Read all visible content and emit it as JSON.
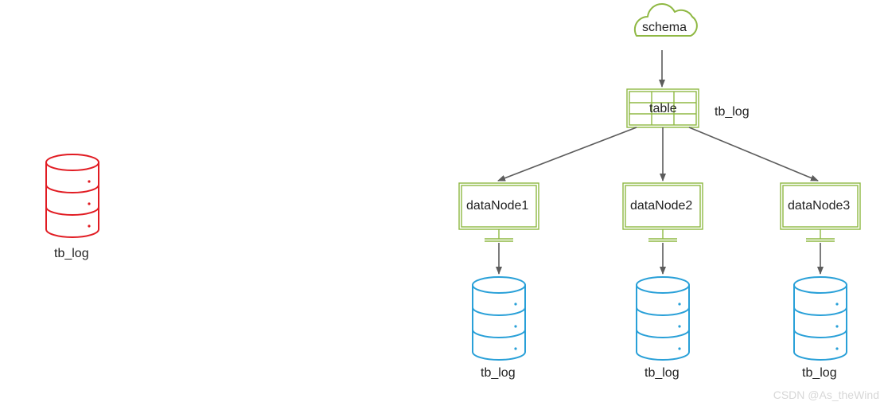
{
  "schema_label": "schema",
  "table_label": "table",
  "table_side_label": "tb_log",
  "data_nodes": [
    "dataNode1",
    "dataNode2",
    "dataNode3"
  ],
  "db_labels": [
    "tb_log",
    "tb_log",
    "tb_log"
  ],
  "left_db_label": "tb_log",
  "watermark": "CSDN @As_theWind",
  "colors": {
    "red": "#e11b22",
    "green": "#8fb843",
    "blue": "#29a0d8",
    "arrow": "#5c5c5c",
    "text": "#222222"
  }
}
